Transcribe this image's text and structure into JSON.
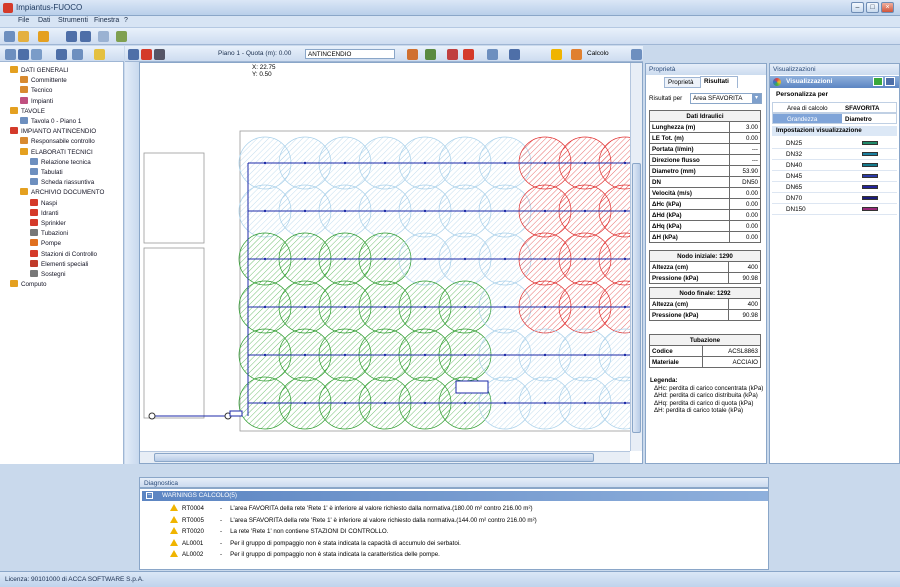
{
  "window": {
    "title": "Impiantus-FUOCO"
  },
  "menu": [
    "File",
    "Dati",
    "Strumenti",
    "Finestra",
    "?"
  ],
  "canvas_toolbar": {
    "floor": "Piano 1 - Quota (m): 0.00",
    "layer": "ANTINCENDIO",
    "calc": "Calcolo"
  },
  "coords": {
    "x": "X: 22.75",
    "y": "Y: 0.50"
  },
  "tree": [
    {
      "label": "DATI GENERALI",
      "level": 0,
      "color": "#e4a020"
    },
    {
      "label": "Committente",
      "level": 1,
      "color": "#d88a30"
    },
    {
      "label": "Tecnico",
      "level": 1,
      "color": "#d88a30"
    },
    {
      "label": "Impianti",
      "level": 1,
      "color": "#c05080"
    },
    {
      "label": "TAVOLE",
      "level": 0,
      "color": "#e4a020"
    },
    {
      "label": "Tavola 0 - Piano 1",
      "level": 1,
      "color": "#6d8fbf"
    },
    {
      "label": "IMPIANTO ANTINCENDIO",
      "level": 0,
      "color": "#d43a2a"
    },
    {
      "label": "Responsabile controllo",
      "level": 1,
      "color": "#d88a30"
    },
    {
      "label": "ELABORATI TECNICI",
      "level": 1,
      "color": "#e4a020"
    },
    {
      "label": "Relazione tecnica",
      "level": 2,
      "color": "#6d8fbf"
    },
    {
      "label": "Tabulati",
      "level": 2,
      "color": "#6d8fbf"
    },
    {
      "label": "Scheda riassuntiva",
      "level": 2,
      "color": "#6d8fbf"
    },
    {
      "label": "ARCHIVIO DOCUMENTO",
      "level": 1,
      "color": "#e4a020"
    },
    {
      "label": "Naspi",
      "level": 2,
      "color": "#d43a2a"
    },
    {
      "label": "Idranti",
      "level": 2,
      "color": "#d43a2a"
    },
    {
      "label": "Sprinkler",
      "level": 2,
      "color": "#d43a2a"
    },
    {
      "label": "Tubazioni",
      "level": 2,
      "color": "#777"
    },
    {
      "label": "Pompe",
      "level": 2,
      "color": "#e07020"
    },
    {
      "label": "Stazioni di Controllo",
      "level": 2,
      "color": "#d43a2a"
    },
    {
      "label": "Elementi speciali",
      "level": 2,
      "color": "#c03a2a"
    },
    {
      "label": "Sostegni",
      "level": 2,
      "color": "#777"
    },
    {
      "label": "Computo",
      "level": 0,
      "color": "#e4a020"
    }
  ],
  "props": {
    "panel_title": "Proprietà",
    "tabs": [
      "Proprietà",
      "Risultati"
    ],
    "results_for_label": "Risultati per",
    "results_for_value": "Area SFAVORITA",
    "hydraulic_title": "Dati Idraulici",
    "hydraulic": [
      {
        "k": "Lunghezza (m)",
        "v": "3.00"
      },
      {
        "k": "LE Tot. (m)",
        "v": "0.00"
      },
      {
        "k": "Portata (l/min)",
        "v": "---"
      },
      {
        "k": "Direzione flusso",
        "v": "---"
      },
      {
        "k": "Diametro (mm)",
        "v": "53.90"
      },
      {
        "k": "DN",
        "v": "DN50"
      },
      {
        "k": "Velocità (m/s)",
        "v": "0.00"
      },
      {
        "k": "ΔHc (kPa)",
        "v": "0.00"
      },
      {
        "k": "ΔHd (kPa)",
        "v": "0.00"
      },
      {
        "k": "ΔHq (kPa)",
        "v": "0.00"
      },
      {
        "k": "ΔH (kPa)",
        "v": "0.00"
      }
    ],
    "start_node_title": "Nodo iniziale: 1290",
    "start_node": [
      {
        "k": "Altezza (cm)",
        "v": "400"
      },
      {
        "k": "Pressione (kPa)",
        "v": "90.98"
      }
    ],
    "end_node_title": "Nodo finale: 1292",
    "end_node": [
      {
        "k": "Altezza (cm)",
        "v": "400"
      },
      {
        "k": "Pressione (kPa)",
        "v": "90.98"
      }
    ],
    "pipe_title": "Tubazione",
    "pipe": [
      {
        "k": "Codice",
        "v": "ACSL8863"
      },
      {
        "k": "Materiale",
        "v": "ACCIAIO"
      }
    ],
    "legend_title": "Legenda:",
    "legend": [
      "ΔHc: perdita di carico concentrata (kPa)",
      "ΔHd: perdita di carico distribuita (kPa)",
      "ΔHq: perdita di carico di quota (kPa)",
      "ΔH: perdita di carico totale (kPa)"
    ]
  },
  "vis": {
    "panel_title": "Visualizzazioni",
    "header": "Visualizzazioni",
    "customize_title": "Personalizza per",
    "rows": [
      {
        "k": "Area di calcolo",
        "v": "SFAVORITA"
      },
      {
        "k": "Grandezza",
        "v": "Diametro"
      }
    ],
    "settings_title": "Impostazioni visualizzazione",
    "dn": [
      {
        "label": "DN25",
        "color": "#1f8a6a"
      },
      {
        "label": "DN32",
        "color": "#1b7fa0"
      },
      {
        "label": "DN40",
        "color": "#147a8c"
      },
      {
        "label": "DN45",
        "color": "#2a3aa8"
      },
      {
        "label": "DN65",
        "color": "#22229a"
      },
      {
        "label": "DN70",
        "color": "#1a1a7a"
      },
      {
        "label": "DN150",
        "color": "#9a2a7a"
      }
    ]
  },
  "diagnostics": {
    "title": "Diagnostica",
    "group": "WARNINGS CALCOLO(5)",
    "rows": [
      {
        "code": "RT0004",
        "text": "L'area FAVORITA della rete 'Rete 1' è inferiore al valore richiesto dalla normativa.(180.00 m²  contro  216.00 m²)"
      },
      {
        "code": "RT0005",
        "text": "L'area SFAVORITA della rete 'Rete 1' è inferiore al valore richiesto dalla normativa.(144.00 m²  contro  216.00 m²)"
      },
      {
        "code": "RT0020",
        "text": "La rete 'Rete 1' non contiene STAZIONI DI CONTROLLO."
      },
      {
        "code": "AL0001",
        "text": "Per il gruppo di pompaggio non è stata indicata la capacità di accumulo dei serbatoi."
      },
      {
        "code": "AL0002",
        "text": "Per il gruppo di pompaggio non è stata indicata la caratteristica delle pompe."
      }
    ]
  },
  "status": "Licenza: 90101000 di ACCA SOFTWARE S.p.A."
}
